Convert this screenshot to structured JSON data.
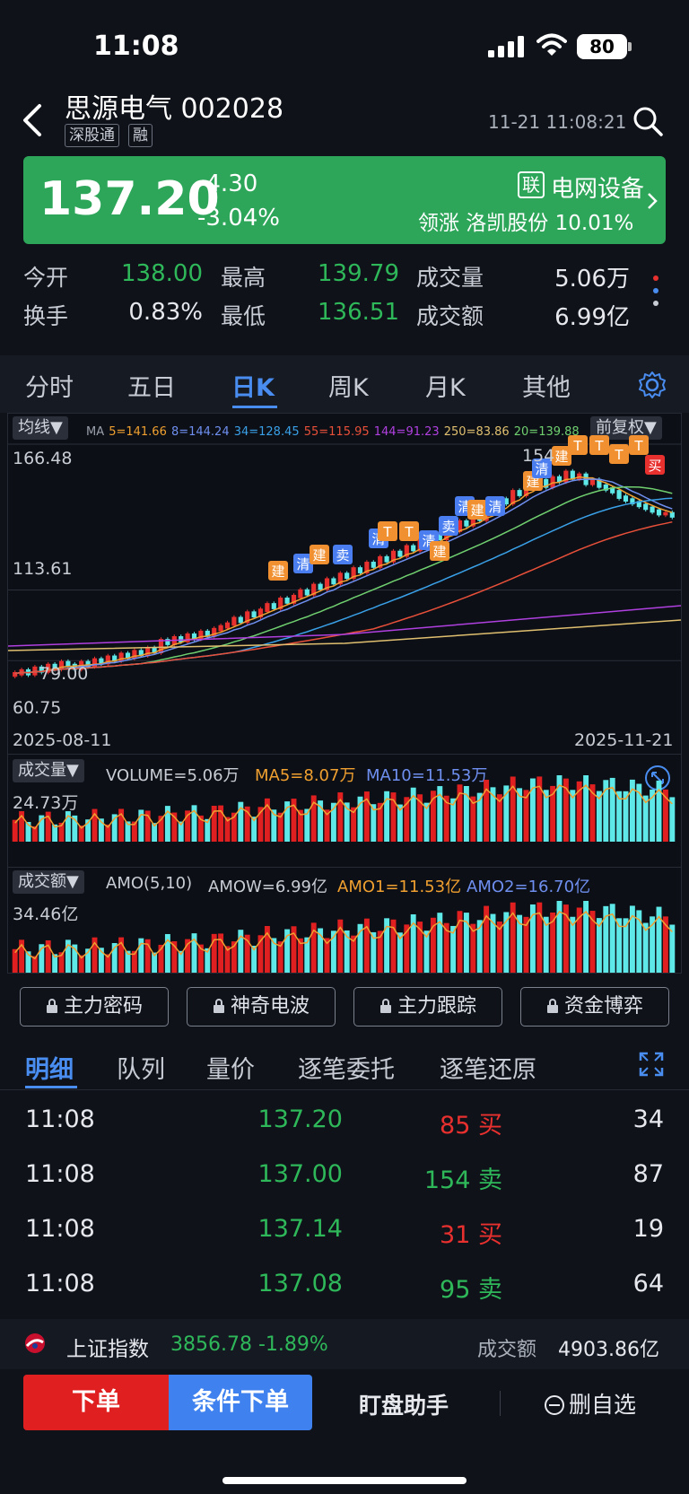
{
  "status": {
    "time": "11:08",
    "battery": "80"
  },
  "header": {
    "name": "思源电气 002028",
    "tags": [
      "深股通",
      "融"
    ],
    "timestamp": "11-21 11:08:21"
  },
  "quote": {
    "price": "137.20",
    "change": "-4.30",
    "pct": "-3.04%",
    "lian": "联",
    "sector": "电网设备",
    "leader": "领涨 洛凯股份 10.01%"
  },
  "stats": {
    "open_label": "今开",
    "open": "138.00",
    "high_label": "最高",
    "high": "139.79",
    "vol_label": "成交量",
    "vol": "5.06万",
    "turn_label": "换手",
    "turn": "0.83%",
    "low_label": "最低",
    "low": "136.51",
    "amt_label": "成交额",
    "amt": "6.99亿"
  },
  "tabs": [
    "分时",
    "五日",
    "日K",
    "周K",
    "月K",
    "其他"
  ],
  "chart": {
    "ma_dropdown": "均线▼",
    "adj_dropdown": "前复权▼",
    "ma_prefix": "MA",
    "ma": [
      {
        "label": "5=141.66",
        "color": "#f0a030"
      },
      {
        "label": "8=144.24",
        "color": "#6f8ff0"
      },
      {
        "label": "34=128.45",
        "color": "#3aa0e8"
      },
      {
        "label": "55=115.95",
        "color": "#e8503a"
      },
      {
        "label": "144=91.23",
        "color": "#b040e0"
      },
      {
        "label": "250=83.86",
        "color": "#e0c070"
      },
      {
        "label": "20=139.88",
        "color": "#70d070"
      }
    ],
    "y_top": "166.48",
    "y_mid": "113.61",
    "y_bottom": "60.75",
    "low_mark": "79.00",
    "high_mark": "154",
    "date_start": "2025-08-11",
    "date_end": "2025-11-21"
  },
  "chart_data": {
    "type": "candlestick",
    "x_range": [
      "2025-08-11",
      "2025-11-21"
    ],
    "ylim": [
      60.75,
      166.48
    ],
    "y_ticks": [
      166.48,
      113.61,
      60.75
    ],
    "marks": {
      "low": 79.0,
      "high": 154
    },
    "closes": [
      80,
      81,
      80,
      82,
      81,
      83,
      82,
      84,
      83,
      82,
      84,
      83,
      85,
      84,
      86,
      85,
      87,
      86,
      88,
      87,
      89,
      88,
      92,
      91,
      93,
      92,
      94,
      93,
      95,
      94,
      96,
      97,
      98,
      100,
      99,
      102,
      101,
      103,
      105,
      104,
      107,
      106,
      108,
      110,
      109,
      112,
      111,
      114,
      113,
      116,
      115,
      118,
      117,
      120,
      119,
      122,
      121,
      124,
      123,
      126,
      125,
      128,
      127,
      130,
      129,
      133,
      132,
      135,
      134,
      137,
      136,
      140,
      139,
      143,
      142,
      146,
      145,
      149,
      148,
      150,
      148,
      151,
      150,
      153,
      151,
      152,
      149,
      150,
      148,
      147,
      146,
      144,
      143,
      142,
      141,
      140,
      139,
      138,
      138,
      137.2
    ],
    "signals": [
      "建",
      "清",
      "卖",
      "建",
      "清",
      "T",
      "T",
      "清",
      "建",
      "卖",
      "清",
      "建",
      "清",
      "建",
      "清",
      "建",
      "T",
      "T",
      "T",
      "T",
      "买"
    ],
    "volume": {
      "label": "成交量▼",
      "text": "VOLUME=5.06万",
      "ma5": "MA5=8.07万",
      "ma10": "MA10=11.53万",
      "y_max": "24.73万"
    },
    "amount": {
      "label": "成交额▼",
      "text1": "AMO(5,10)",
      "text2": "AMOW=6.99亿",
      "amo1": "AMO1=11.53亿",
      "amo2": "AMO2=16.70亿",
      "y_max": "34.46亿"
    }
  },
  "features": [
    "主力密码",
    "神奇电波",
    "主力跟踪",
    "资金博弈"
  ],
  "detail_tabs": [
    "明细",
    "队列",
    "量价",
    "逐笔委托",
    "逐笔还原"
  ],
  "trades": [
    {
      "time": "11:08",
      "price": "137.20",
      "vol": "85",
      "side": "买",
      "dir": "buy",
      "num": "34"
    },
    {
      "time": "11:08",
      "price": "137.00",
      "vol": "154",
      "side": "卖",
      "dir": "sell",
      "num": "87"
    },
    {
      "time": "11:08",
      "price": "137.14",
      "vol": "31",
      "side": "买",
      "dir": "buy",
      "num": "19"
    },
    {
      "time": "11:08",
      "price": "137.08",
      "vol": "95",
      "side": "卖",
      "dir": "sell",
      "num": "64"
    }
  ],
  "index": {
    "name": "上证指数",
    "value": "3856.78  -1.89%",
    "amt_label": "成交额",
    "amt": "4903.86亿"
  },
  "actions": {
    "order": "下单",
    "cond": "条件下单",
    "helper": "盯盘助手",
    "remove": "删自选"
  }
}
